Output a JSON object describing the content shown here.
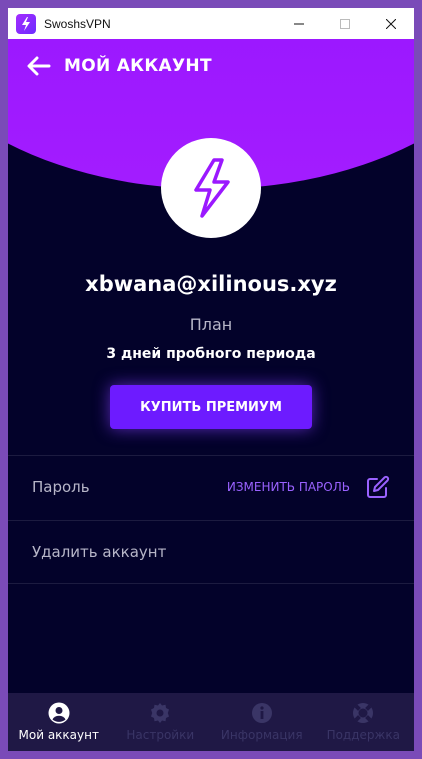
{
  "window": {
    "title": "SwoshsVPN"
  },
  "header": {
    "title": "МОЙ АККАУНТ"
  },
  "account": {
    "email": "xbwana@xilinous.xyz",
    "plan_label": "План",
    "plan_value": "3 дней пробного периода",
    "buy_button": "КУПИТЬ ПРЕМИУМ"
  },
  "rows": {
    "password_label": "Пароль",
    "change_password": "ИЗМЕНИТЬ ПАРОЛЬ",
    "delete_label": "Удалить аккаунт"
  },
  "nav": [
    {
      "label": "Мой аккаунт",
      "icon": "account-icon",
      "active": true
    },
    {
      "label": "Настройки",
      "icon": "gear-icon",
      "active": false
    },
    {
      "label": "Информация",
      "icon": "info-icon",
      "active": false
    },
    {
      "label": "Поддержка",
      "icon": "support-icon",
      "active": false
    }
  ],
  "colors": {
    "accent": "#6d1bff",
    "background": "#03022a",
    "hero": "#9b18ff",
    "link": "#9a62ff"
  }
}
